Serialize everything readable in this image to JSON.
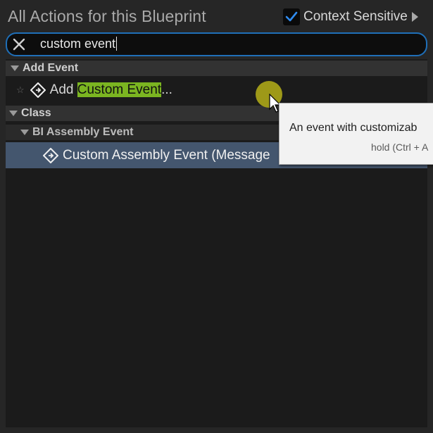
{
  "header": {
    "title": "All Actions for this Blueprint",
    "context_sensitive_label": "Context Sensitive",
    "context_sensitive_checked": true
  },
  "search": {
    "query": "custom event",
    "clear_icon": "close-icon"
  },
  "tree": {
    "add_event_category": "Add Event",
    "add_custom_event": {
      "prefix": "Add ",
      "match": "Custom Event",
      "suffix": "..."
    },
    "class_category": "Class",
    "bi_assembly_category": "BI Assembly Event",
    "custom_assembly_event": "Custom Assembly Event (Message"
  },
  "tooltip": {
    "text": "An event with customizab",
    "hint": "hold (Ctrl + A"
  },
  "colors": {
    "highlight": "#7bb521",
    "selection": "#44566e",
    "search_border": "#1f6fb8",
    "cursor_indicator": "#a5a018"
  }
}
